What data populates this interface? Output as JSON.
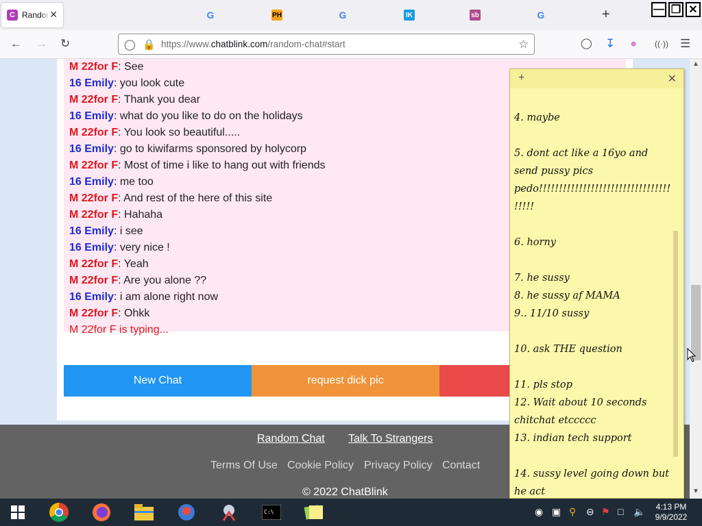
{
  "browser": {
    "active_tab": {
      "favicon": "C",
      "title": "Random Chat"
    },
    "pinned_tabs": [
      {
        "icon": "google-icon",
        "label": "G"
      },
      {
        "icon": "ph-icon",
        "label": "PH"
      },
      {
        "icon": "google-icon",
        "label": "G"
      },
      {
        "icon": "ik-icon",
        "label": "IK"
      },
      {
        "icon": "sb-icon",
        "label": "sb"
      },
      {
        "icon": "google-icon",
        "label": "G"
      }
    ],
    "url": {
      "prefix": "https://www.",
      "host": "chatblink.com",
      "path": "/random-chat#start"
    }
  },
  "chat": {
    "messages": [
      {
        "sender": "M 22for F",
        "type": "m",
        "text": ": See"
      },
      {
        "sender": "16 Emily",
        "type": "e",
        "text": ": you look cute"
      },
      {
        "sender": "M 22for F",
        "type": "m",
        "text": ": Thank you dear"
      },
      {
        "sender": "16 Emily",
        "type": "e",
        "text": ": what do you like to do on the holidays"
      },
      {
        "sender": "M 22for F",
        "type": "m",
        "text": ": You look so beautiful....."
      },
      {
        "sender": "16 Emily",
        "type": "e",
        "text": ": go to kiwifarms sponsored by holycorp"
      },
      {
        "sender": "M 22for F",
        "type": "m",
        "text": ": Most of time i like to hang out with friends"
      },
      {
        "sender": "16 Emily",
        "type": "e",
        "text": ": me too"
      },
      {
        "sender": "M 22for F",
        "type": "m",
        "text": ": And rest of the here of this site"
      },
      {
        "sender": "M 22for F",
        "type": "m",
        "text": ": Hahaha"
      },
      {
        "sender": "16 Emily",
        "type": "e",
        "text": ": i see"
      },
      {
        "sender": "16 Emily",
        "type": "e",
        "text": ": very nice !"
      },
      {
        "sender": "M 22for F",
        "type": "m",
        "text": ": Yeah"
      },
      {
        "sender": "M 22for F",
        "type": "m",
        "text": ": Are you alone ??"
      },
      {
        "sender": "16 Emily",
        "type": "e",
        "text": ": i am alone right now"
      },
      {
        "sender": "M 22for F",
        "type": "m",
        "text": ": Ohkk"
      }
    ],
    "typing_status": "M 22for F is typing..."
  },
  "buttons": {
    "new_chat": "New Chat",
    "request": "request dick pic",
    "colors": {
      "new_chat": "#2196f3",
      "request": "#f0933a",
      "stop": "#ea4a4a"
    }
  },
  "footer": {
    "link_random_chat": "Random Chat",
    "link_talk": "Talk To Strangers",
    "terms": "Terms Of Use",
    "cookie": "Cookie Policy",
    "privacy": "Privacy Policy",
    "contact": "Contact",
    "copyright": "© 2022 ChatBlink"
  },
  "sticky_note": {
    "text": "4. maybe\n\n5. dont act like a 16yo and send pussy pics pedo!!!!!!!!!!!!!!!!!!!!!!!!!!!!!!!!!!!!!!\n\n6. horny\n\n7. he sussy\n8. he sussy af MAMA\n9.. 11/10 sussy\n\n10. ask THE question\n\n11. pls stop\n12. Wait about 10 seconds chitchat etccccc\n13. indian tech support\n\n14. sussy level going down but he act"
  },
  "taskbar": {
    "time": "4:13 PM",
    "date": "9/9/2022"
  }
}
